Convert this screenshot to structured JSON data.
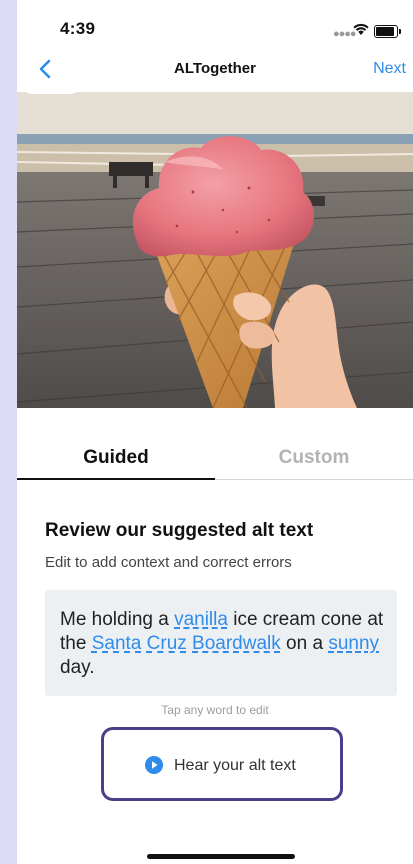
{
  "status_bar": {
    "time": "4:39",
    "icons": [
      "signal-icon",
      "wifi-icon",
      "battery-icon"
    ]
  },
  "nav": {
    "back_icon": "chevron-left-icon",
    "title": "ALTogether",
    "next_label": "Next"
  },
  "photo": {
    "description_icon": "ice-cream-photo"
  },
  "tabs": [
    {
      "label": "Guided",
      "active": true
    },
    {
      "label": "Custom",
      "active": false
    }
  ],
  "review": {
    "heading": "Review our suggested alt text",
    "subheading": "Edit to add context and correct errors",
    "alt_text": {
      "p1": "Me holding a ",
      "w1": "vanilla",
      "p2": " ice cream cone at the ",
      "w2": "Santa",
      "p3": " ",
      "w3": "Cruz",
      "p4": " ",
      "w4": "Boardwalk",
      "p5": " on a ",
      "w5": "sunny",
      "p6": " day."
    },
    "hint": "Tap any word to edit"
  },
  "hear_button": {
    "label": "Hear your alt text",
    "icon": "play-circle-icon"
  },
  "colors": {
    "accent": "#2f8cea",
    "button_border": "#4a3d8a",
    "card_bg": "#edf0f3",
    "background": "#dcdcf7"
  }
}
